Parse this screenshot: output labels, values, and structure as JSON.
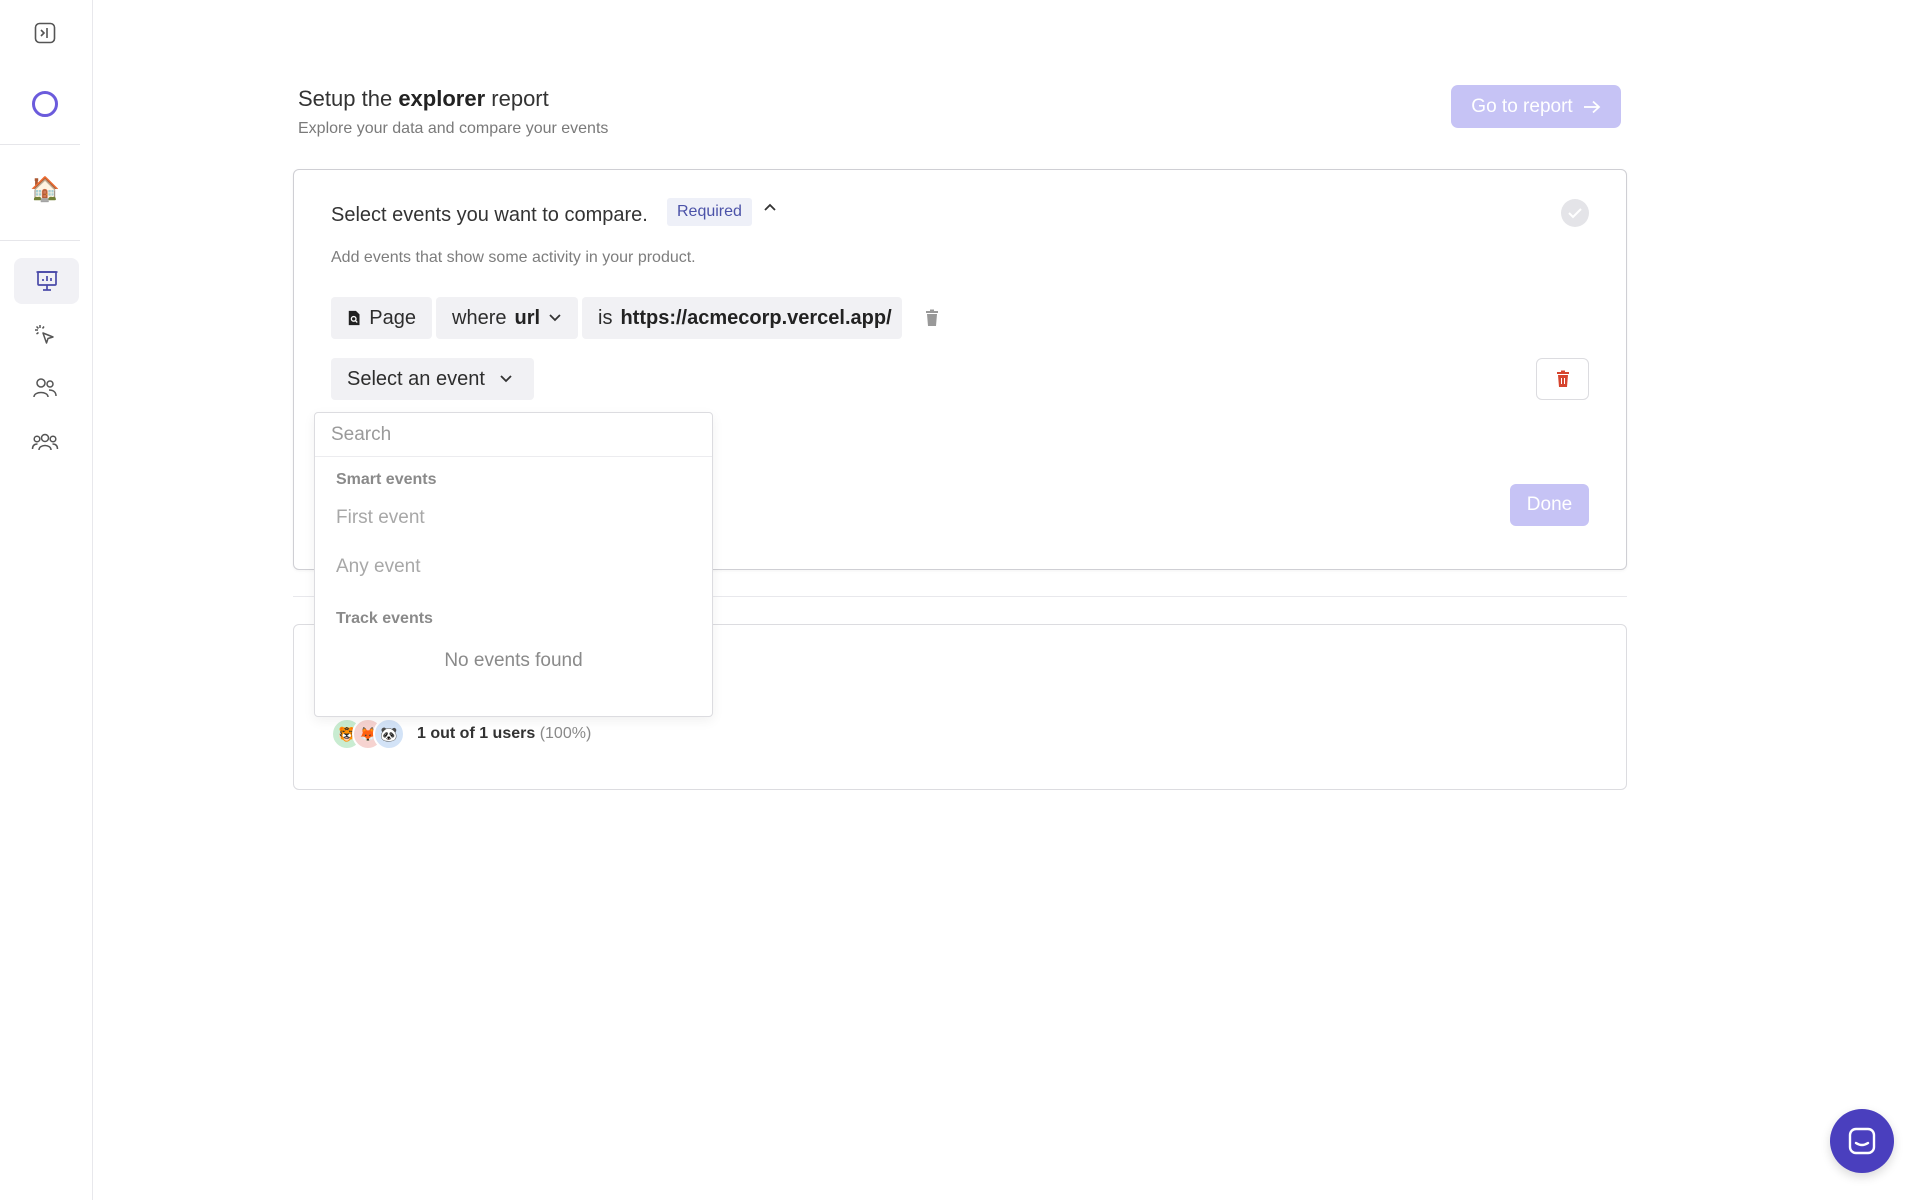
{
  "sidebar": {
    "items": [
      {
        "name": "expand-sidebar",
        "icon": "sidebar-expand-icon"
      },
      {
        "name": "logo",
        "icon": "logo-ring-icon"
      },
      {
        "name": "home",
        "icon": "house-emoji-icon",
        "glyph": "🏠"
      },
      {
        "name": "reports",
        "icon": "presentation-chart-icon",
        "active": true
      },
      {
        "name": "autocapture",
        "icon": "cursor-click-icon"
      },
      {
        "name": "people",
        "icon": "users-icon"
      },
      {
        "name": "companies",
        "icon": "user-group-icon"
      }
    ],
    "accent": "#6b5bdc"
  },
  "header": {
    "title_prefix": "Setup the",
    "title_bold": "explorer",
    "title_suffix": "report",
    "subtitle": "Explore your data and compare your events",
    "go_button": "Go to report"
  },
  "step": {
    "title": "Select events you want to compare.",
    "badge": "Required",
    "subtitle": "Add events that show some activity in your product.",
    "filter": {
      "event_label": "Page",
      "where_label": "where",
      "property": "url",
      "operator": "is",
      "value": "https://acmecorp.vercel.app/"
    },
    "select_event": "Select an event",
    "done_button": "Done"
  },
  "dropdown": {
    "search_placeholder": "Search",
    "smart_group": "Smart events",
    "smart_items": [
      "First event",
      "Any event"
    ],
    "track_group": "Track events",
    "track_empty": "No events found"
  },
  "audience": {
    "avatars": [
      "🐯",
      "🦊",
      "🐼"
    ],
    "count_text": "1 out of 1 users",
    "percent_text": "(100%)"
  },
  "colors": {
    "primary_disabled": "#c6c3f5",
    "chat": "#4a3fbe",
    "danger": "#d6452f"
  }
}
